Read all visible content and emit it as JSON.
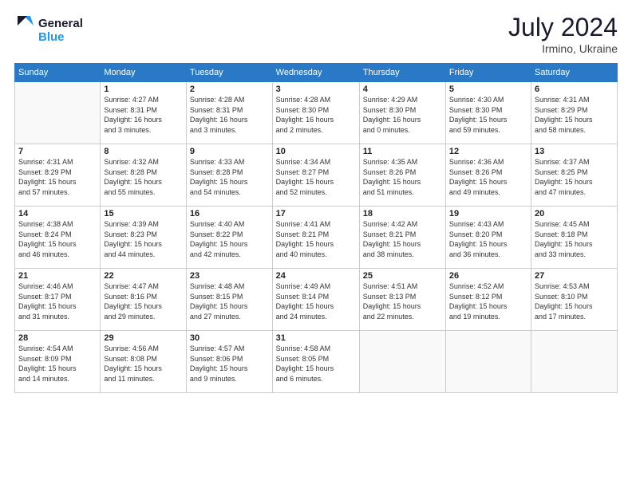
{
  "header": {
    "logo_line1": "General",
    "logo_line2": "Blue",
    "month_year": "July 2024",
    "location": "Irmino, Ukraine"
  },
  "weekdays": [
    "Sunday",
    "Monday",
    "Tuesday",
    "Wednesday",
    "Thursday",
    "Friday",
    "Saturday"
  ],
  "weeks": [
    [
      {
        "day": "",
        "info": ""
      },
      {
        "day": "1",
        "info": "Sunrise: 4:27 AM\nSunset: 8:31 PM\nDaylight: 16 hours\nand 3 minutes."
      },
      {
        "day": "2",
        "info": "Sunrise: 4:28 AM\nSunset: 8:31 PM\nDaylight: 16 hours\nand 3 minutes."
      },
      {
        "day": "3",
        "info": "Sunrise: 4:28 AM\nSunset: 8:30 PM\nDaylight: 16 hours\nand 2 minutes."
      },
      {
        "day": "4",
        "info": "Sunrise: 4:29 AM\nSunset: 8:30 PM\nDaylight: 16 hours\nand 0 minutes."
      },
      {
        "day": "5",
        "info": "Sunrise: 4:30 AM\nSunset: 8:30 PM\nDaylight: 15 hours\nand 59 minutes."
      },
      {
        "day": "6",
        "info": "Sunrise: 4:31 AM\nSunset: 8:29 PM\nDaylight: 15 hours\nand 58 minutes."
      }
    ],
    [
      {
        "day": "7",
        "info": "Sunrise: 4:31 AM\nSunset: 8:29 PM\nDaylight: 15 hours\nand 57 minutes."
      },
      {
        "day": "8",
        "info": "Sunrise: 4:32 AM\nSunset: 8:28 PM\nDaylight: 15 hours\nand 55 minutes."
      },
      {
        "day": "9",
        "info": "Sunrise: 4:33 AM\nSunset: 8:28 PM\nDaylight: 15 hours\nand 54 minutes."
      },
      {
        "day": "10",
        "info": "Sunrise: 4:34 AM\nSunset: 8:27 PM\nDaylight: 15 hours\nand 52 minutes."
      },
      {
        "day": "11",
        "info": "Sunrise: 4:35 AM\nSunset: 8:26 PM\nDaylight: 15 hours\nand 51 minutes."
      },
      {
        "day": "12",
        "info": "Sunrise: 4:36 AM\nSunset: 8:26 PM\nDaylight: 15 hours\nand 49 minutes."
      },
      {
        "day": "13",
        "info": "Sunrise: 4:37 AM\nSunset: 8:25 PM\nDaylight: 15 hours\nand 47 minutes."
      }
    ],
    [
      {
        "day": "14",
        "info": "Sunrise: 4:38 AM\nSunset: 8:24 PM\nDaylight: 15 hours\nand 46 minutes."
      },
      {
        "day": "15",
        "info": "Sunrise: 4:39 AM\nSunset: 8:23 PM\nDaylight: 15 hours\nand 44 minutes."
      },
      {
        "day": "16",
        "info": "Sunrise: 4:40 AM\nSunset: 8:22 PM\nDaylight: 15 hours\nand 42 minutes."
      },
      {
        "day": "17",
        "info": "Sunrise: 4:41 AM\nSunset: 8:21 PM\nDaylight: 15 hours\nand 40 minutes."
      },
      {
        "day": "18",
        "info": "Sunrise: 4:42 AM\nSunset: 8:21 PM\nDaylight: 15 hours\nand 38 minutes."
      },
      {
        "day": "19",
        "info": "Sunrise: 4:43 AM\nSunset: 8:20 PM\nDaylight: 15 hours\nand 36 minutes."
      },
      {
        "day": "20",
        "info": "Sunrise: 4:45 AM\nSunset: 8:18 PM\nDaylight: 15 hours\nand 33 minutes."
      }
    ],
    [
      {
        "day": "21",
        "info": "Sunrise: 4:46 AM\nSunset: 8:17 PM\nDaylight: 15 hours\nand 31 minutes."
      },
      {
        "day": "22",
        "info": "Sunrise: 4:47 AM\nSunset: 8:16 PM\nDaylight: 15 hours\nand 29 minutes."
      },
      {
        "day": "23",
        "info": "Sunrise: 4:48 AM\nSunset: 8:15 PM\nDaylight: 15 hours\nand 27 minutes."
      },
      {
        "day": "24",
        "info": "Sunrise: 4:49 AM\nSunset: 8:14 PM\nDaylight: 15 hours\nand 24 minutes."
      },
      {
        "day": "25",
        "info": "Sunrise: 4:51 AM\nSunset: 8:13 PM\nDaylight: 15 hours\nand 22 minutes."
      },
      {
        "day": "26",
        "info": "Sunrise: 4:52 AM\nSunset: 8:12 PM\nDaylight: 15 hours\nand 19 minutes."
      },
      {
        "day": "27",
        "info": "Sunrise: 4:53 AM\nSunset: 8:10 PM\nDaylight: 15 hours\nand 17 minutes."
      }
    ],
    [
      {
        "day": "28",
        "info": "Sunrise: 4:54 AM\nSunset: 8:09 PM\nDaylight: 15 hours\nand 14 minutes."
      },
      {
        "day": "29",
        "info": "Sunrise: 4:56 AM\nSunset: 8:08 PM\nDaylight: 15 hours\nand 11 minutes."
      },
      {
        "day": "30",
        "info": "Sunrise: 4:57 AM\nSunset: 8:06 PM\nDaylight: 15 hours\nand 9 minutes."
      },
      {
        "day": "31",
        "info": "Sunrise: 4:58 AM\nSunset: 8:05 PM\nDaylight: 15 hours\nand 6 minutes."
      },
      {
        "day": "",
        "info": ""
      },
      {
        "day": "",
        "info": ""
      },
      {
        "day": "",
        "info": ""
      }
    ]
  ]
}
